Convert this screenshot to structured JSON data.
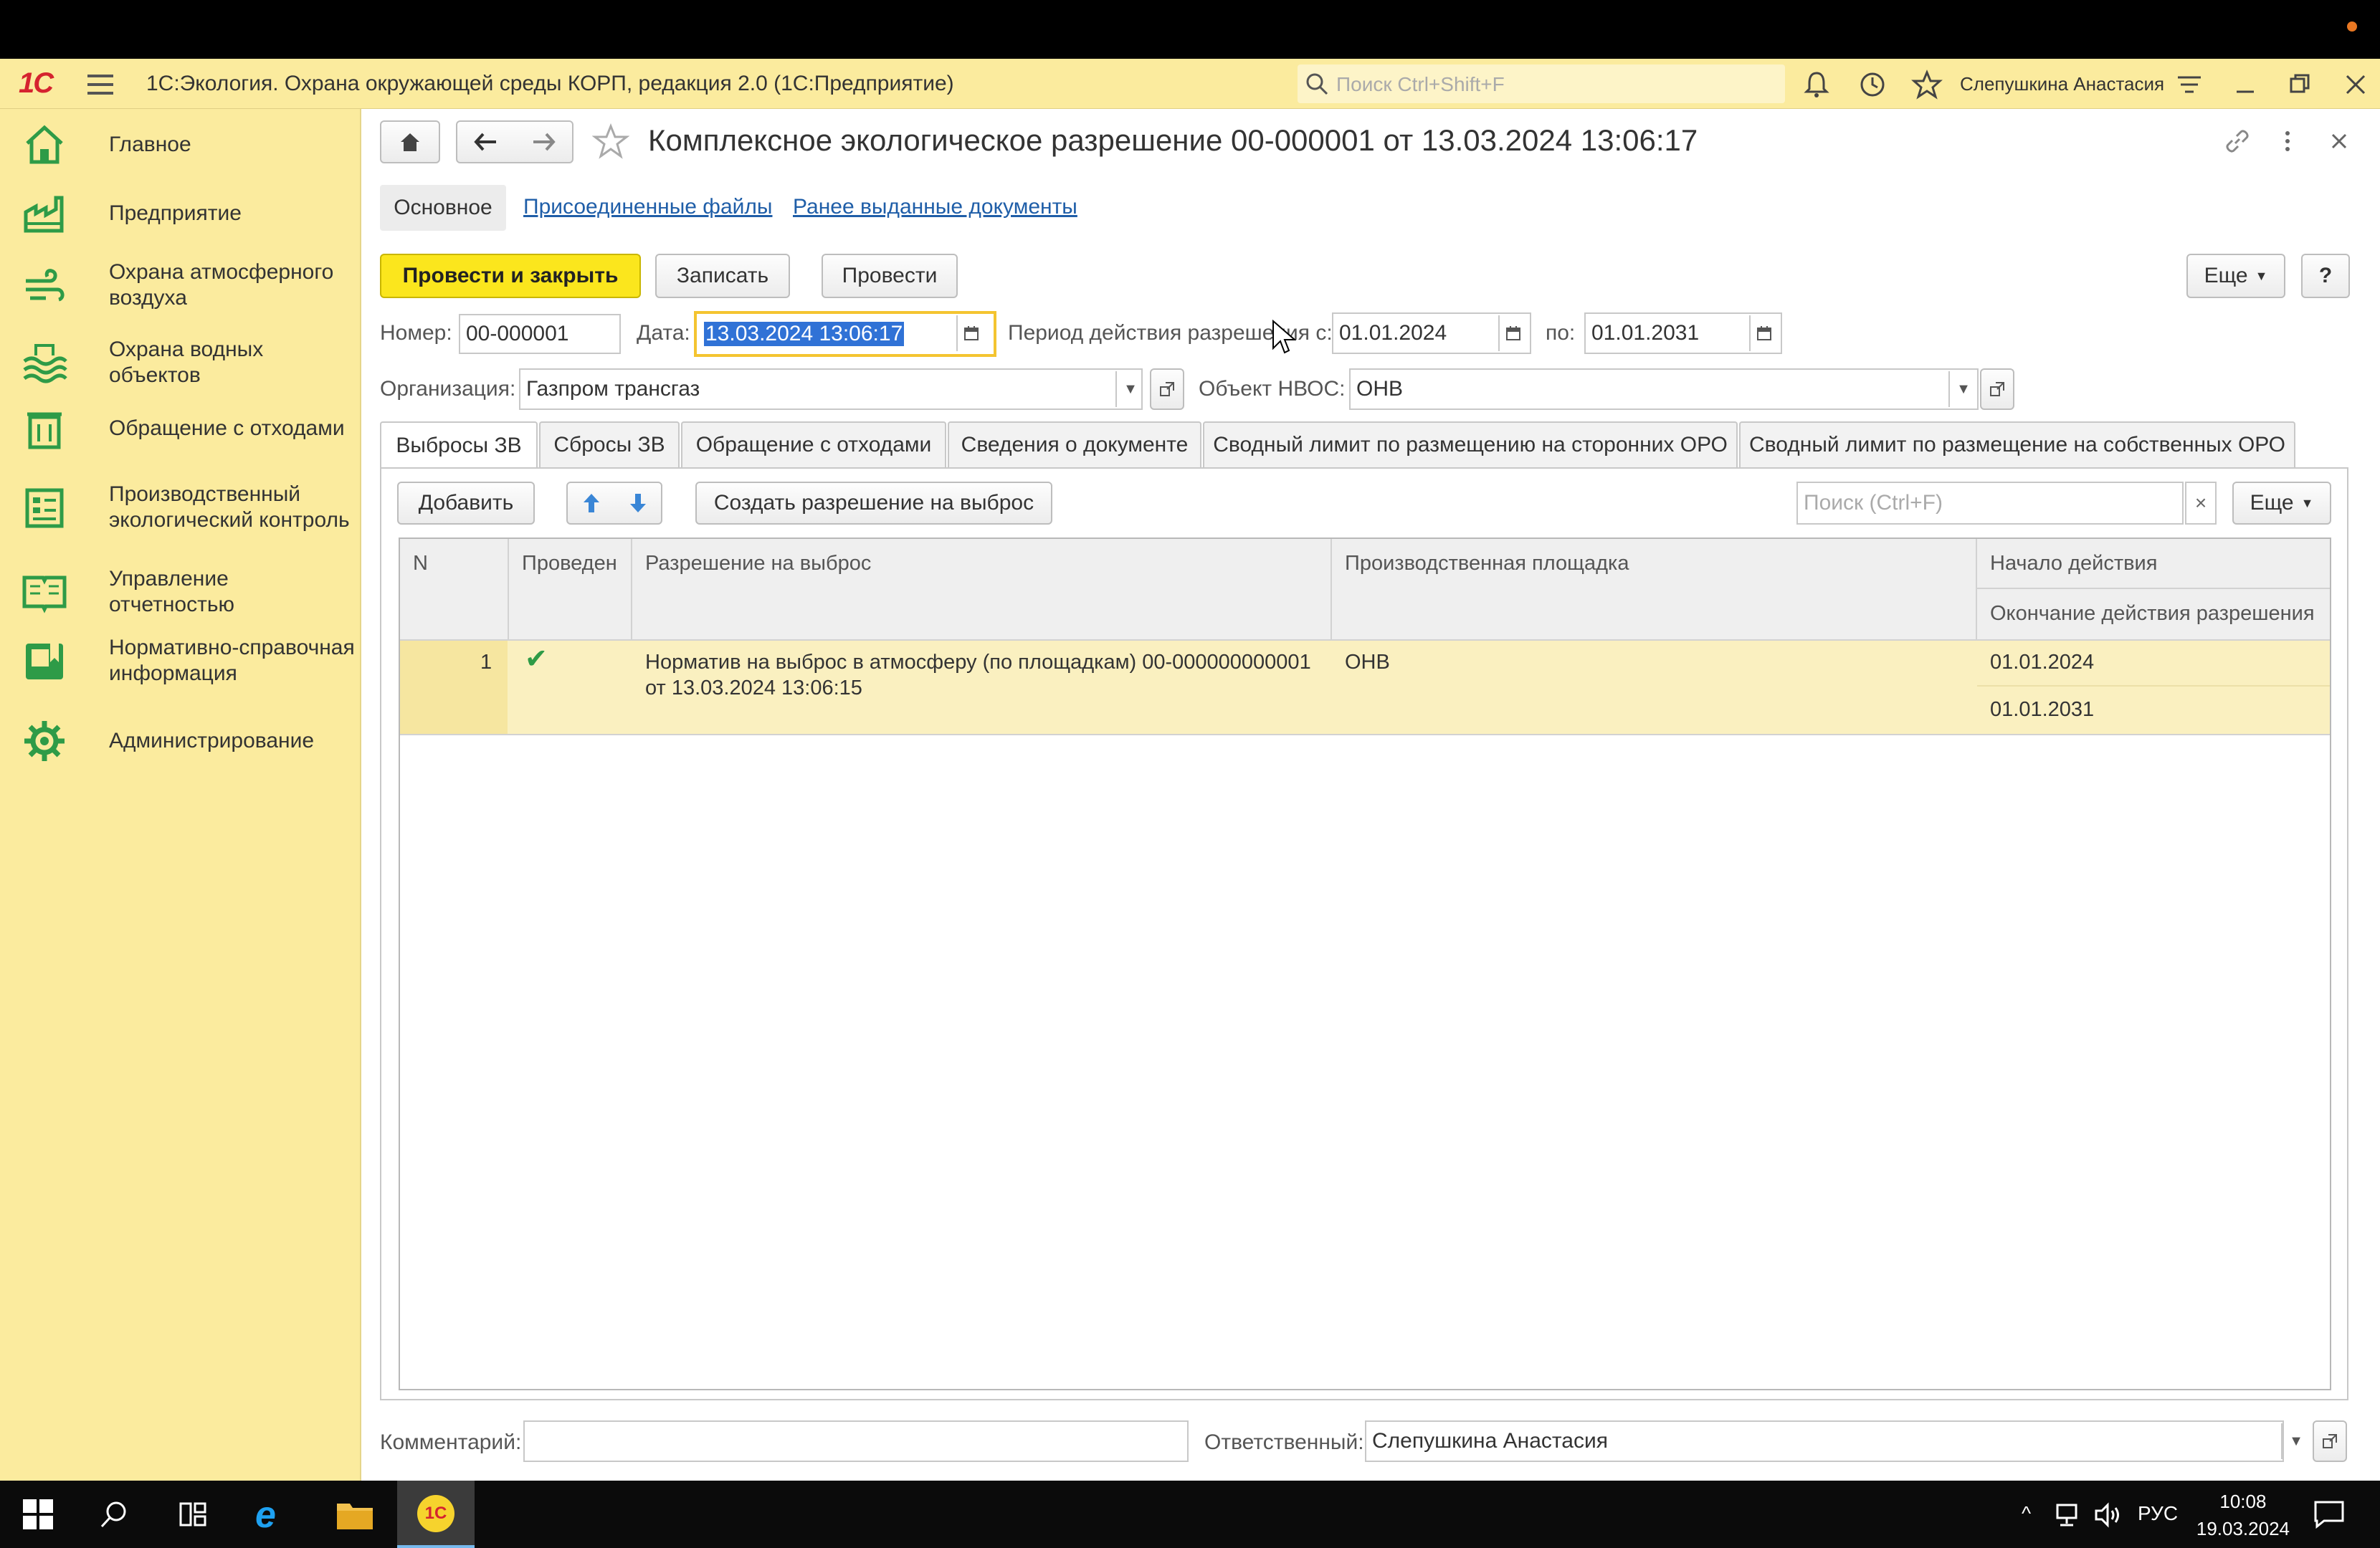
{
  "titlebar": {
    "app_title": "1С:Экология. Охрана окружающей среды КОРП, редакция 2.0  (1С:Предприятие)",
    "search_placeholder": "Поиск Ctrl+Shift+F",
    "user_name": "Слепушкина Анастасия"
  },
  "sidebar": {
    "items": [
      {
        "label": "Главное",
        "icon": "home-icon"
      },
      {
        "label": "Предприятие",
        "icon": "factory-icon"
      },
      {
        "label": "Охрана атмосферного воздуха",
        "icon": "air-icon"
      },
      {
        "label": "Охрана водных объектов",
        "icon": "water-icon"
      },
      {
        "label": "Обращение с отходами",
        "icon": "waste-icon"
      },
      {
        "label": "Производственный экологический контроль",
        "icon": "control-icon"
      },
      {
        "label": "Управление отчетностью",
        "icon": "report-icon"
      },
      {
        "label": "Нормативно-справочная информация",
        "icon": "reference-icon"
      },
      {
        "label": "Администрирование",
        "icon": "gear-icon"
      }
    ]
  },
  "document": {
    "title": "Комплексное экологическое разрешение 00-000001 от 13.03.2024 13:06:17",
    "nav_tabs": [
      "Основное",
      "Присоединенные файлы",
      "Ранее выданные документы"
    ],
    "buttons": {
      "post_close": "Провести и закрыть",
      "save": "Записать",
      "post": "Провести",
      "more": "Еще",
      "help": "?"
    },
    "fields": {
      "number_label": "Номер:",
      "number_value": "00-000001",
      "date_label": "Дата:",
      "date_value": "13.03.2024 13:06:17",
      "period_label": "Период действия разрешения с:",
      "period_from": "01.01.2024",
      "period_to_label": "по:",
      "period_to": "01.01.2031",
      "org_label": "Организация:",
      "org_value": "Газпром трансгаз",
      "object_label": "Объект НВОС:",
      "object_value": "ОНВ",
      "comment_label": "Комментарий:",
      "comment_value": "",
      "responsible_label": "Ответственный:",
      "responsible_value": "Слепушкина Анастасия"
    },
    "tabs": [
      "Выбросы ЗВ",
      "Сбросы ЗВ",
      "Обращение с отходами",
      "Сведения о документе",
      "Сводный лимит по размещению на сторонних ОРО",
      "Сводный лимит по размещение на собственных ОРО"
    ],
    "table_toolbar": {
      "add": "Добавить",
      "create_permit": "Создать разрешение на выброс",
      "search_placeholder": "Поиск (Ctrl+F)",
      "more": "Еще"
    },
    "table": {
      "columns": [
        "N",
        "Проведен",
        "Разрешение на выброс",
        "Производственная площадка",
        "Начало действия",
        "Окончание действия разрешения"
      ],
      "rows": [
        {
          "n": "1",
          "posted": "✔",
          "permit_line1": "Норматив на выброс в атмосферу (по площадкам) 00-000000000001",
          "permit_line2": "от 13.03.2024 13:06:15",
          "site": "ОНВ",
          "start": "01.01.2024",
          "end": "01.01.2031"
        }
      ]
    }
  },
  "taskbar": {
    "lang": "РУС",
    "time": "10:08",
    "date": "19.03.2024"
  },
  "colors": {
    "accent_yellow": "#fbe61d",
    "panel_yellow": "#fbeb9e",
    "icon_green": "#2e9b47",
    "link_blue": "#1f5ea8"
  }
}
